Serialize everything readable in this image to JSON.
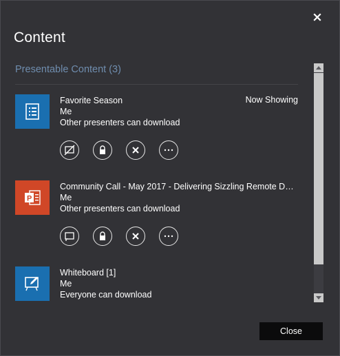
{
  "dialog": {
    "title": "Content",
    "close_icon": "close-x-icon"
  },
  "section": {
    "heading": "Presentable Content (3)"
  },
  "items": [
    {
      "icon": "document-list-icon",
      "thumb_color": "#1a6fb0",
      "name": "Favorite Season",
      "owner": "Me",
      "permission": "Other presenters can download",
      "status": "Now Showing",
      "actions": [
        "stop-presenting-icon",
        "lock-icon",
        "remove-icon",
        "more-options-icon"
      ]
    },
    {
      "icon": "powerpoint-icon",
      "thumb_color": "#d04727",
      "name": "Community Call - May 2017 - Delivering Sizzling Remote Demos...",
      "owner": "Me",
      "permission": "Other presenters can download",
      "status": "",
      "actions": [
        "present-icon",
        "lock-icon",
        "remove-icon",
        "more-options-icon"
      ]
    },
    {
      "icon": "whiteboard-icon",
      "thumb_color": "#1a6fb0",
      "name": "Whiteboard [1]",
      "owner": "Me",
      "permission": "Everyone can download",
      "status": ""
    }
  ],
  "footer": {
    "close_label": "Close"
  }
}
